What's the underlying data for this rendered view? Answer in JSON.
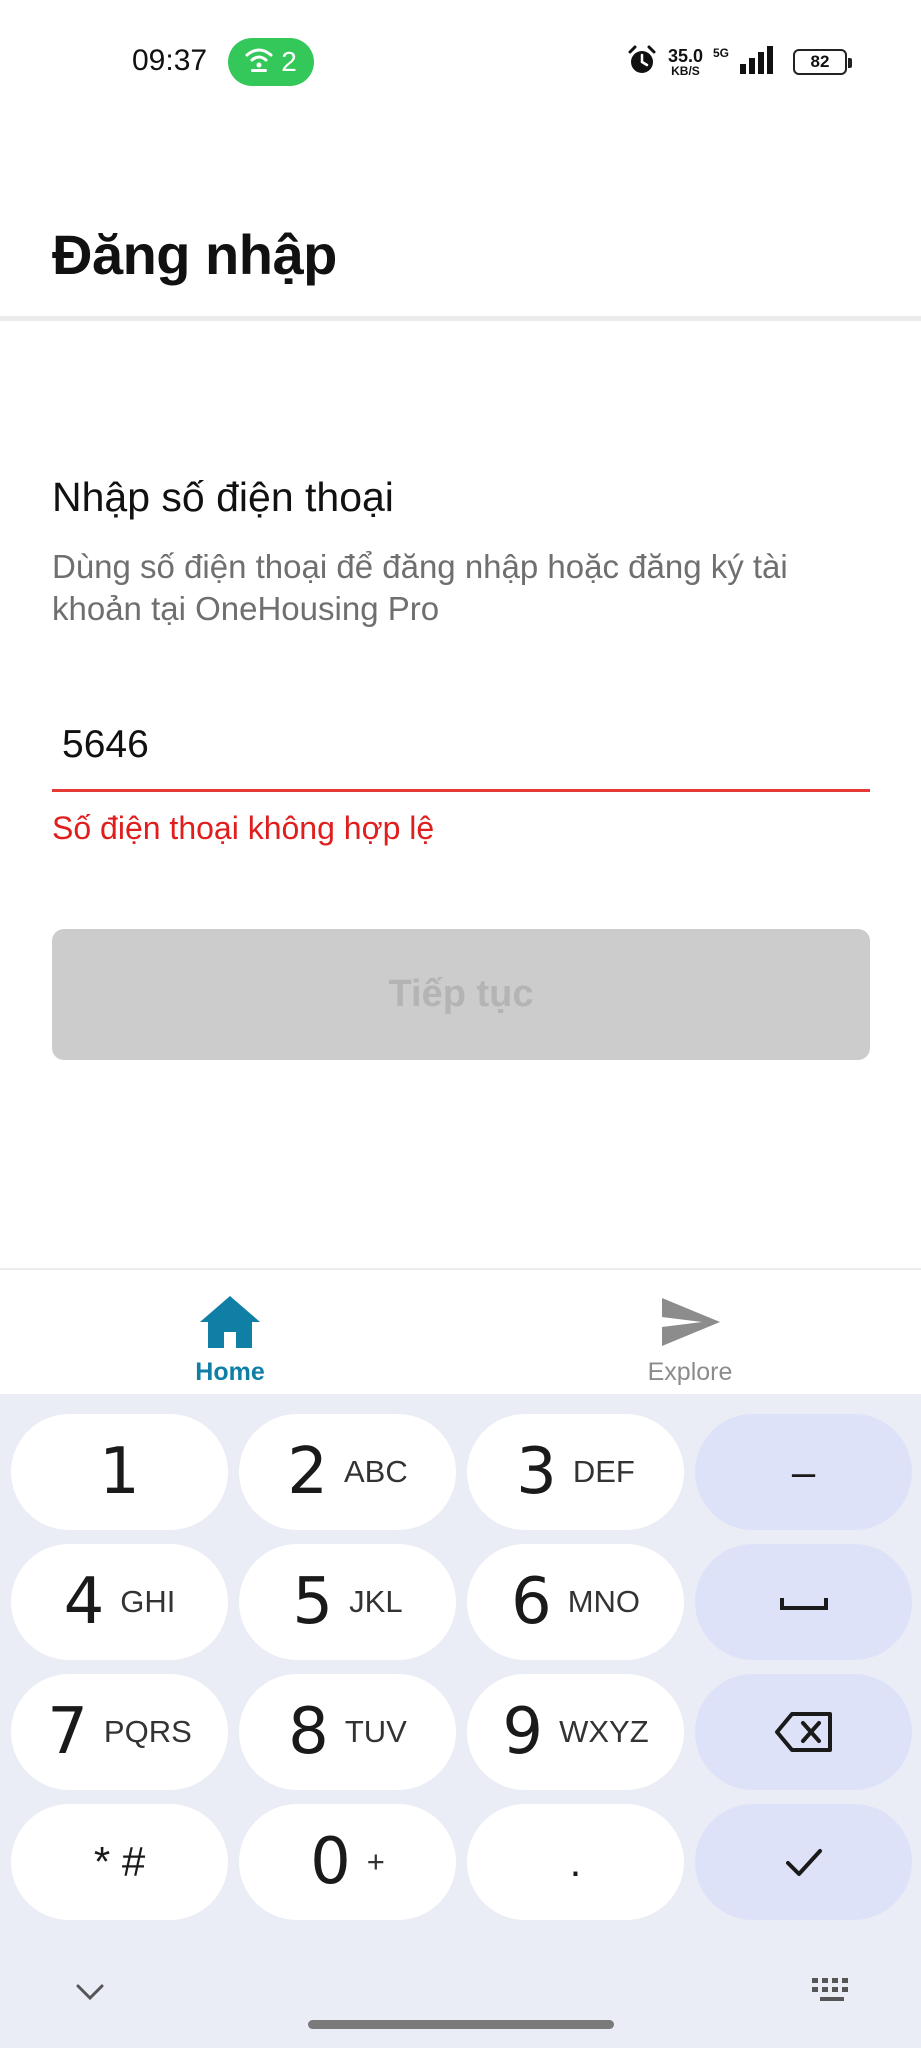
{
  "status_bar": {
    "time": "09:37",
    "wifi_count": "2",
    "speed_value": "35.0",
    "speed_unit": "KB/S",
    "network": "5G",
    "battery": "82",
    "icons": [
      "wifi-icon",
      "alarm-icon",
      "signal-icon",
      "battery-icon"
    ]
  },
  "header": {
    "title": "Đăng nhập"
  },
  "form": {
    "section_title": "Nhập số điện thoại",
    "description": "Dùng số điện thoại để đăng nhập hoặc đăng ký tài khoản tại OneHousing Pro",
    "phone_value": "5646",
    "error": "Số điện thoại không hợp lệ",
    "continue_label": "Tiếp tục"
  },
  "bottom_nav": {
    "items": [
      {
        "label": "Home",
        "icon": "home-icon",
        "active": true
      },
      {
        "label": "Explore",
        "icon": "send-icon",
        "active": false
      }
    ]
  },
  "keyboard": {
    "rows": [
      [
        {
          "main": "1",
          "sub": ""
        },
        {
          "main": "2",
          "sub": "ABC"
        },
        {
          "main": "3",
          "sub": "DEF"
        },
        {
          "main": "–",
          "sub": ""
        }
      ],
      [
        {
          "main": "4",
          "sub": "GHI"
        },
        {
          "main": "5",
          "sub": "JKL"
        },
        {
          "main": "6",
          "sub": "MNO"
        },
        {
          "main": "space",
          "sub": ""
        }
      ],
      [
        {
          "main": "7",
          "sub": "PQRS"
        },
        {
          "main": "8",
          "sub": "TUV"
        },
        {
          "main": "9",
          "sub": "WXYZ"
        },
        {
          "main": "backspace",
          "sub": ""
        }
      ],
      [
        {
          "main": "* #",
          "sub": ""
        },
        {
          "main": "0",
          "sub": "+"
        },
        {
          "main": ".",
          "sub": ""
        },
        {
          "main": "done",
          "sub": ""
        }
      ]
    ]
  },
  "colors": {
    "error_red": "#e01e1e",
    "underline_red": "#e53935",
    "active_nav": "#0f7fa6",
    "disabled_button": "#cccccc",
    "wifi_pill": "#34c759",
    "keyboard_bg": "#eaecf6",
    "side_key": "#dde2f8"
  }
}
